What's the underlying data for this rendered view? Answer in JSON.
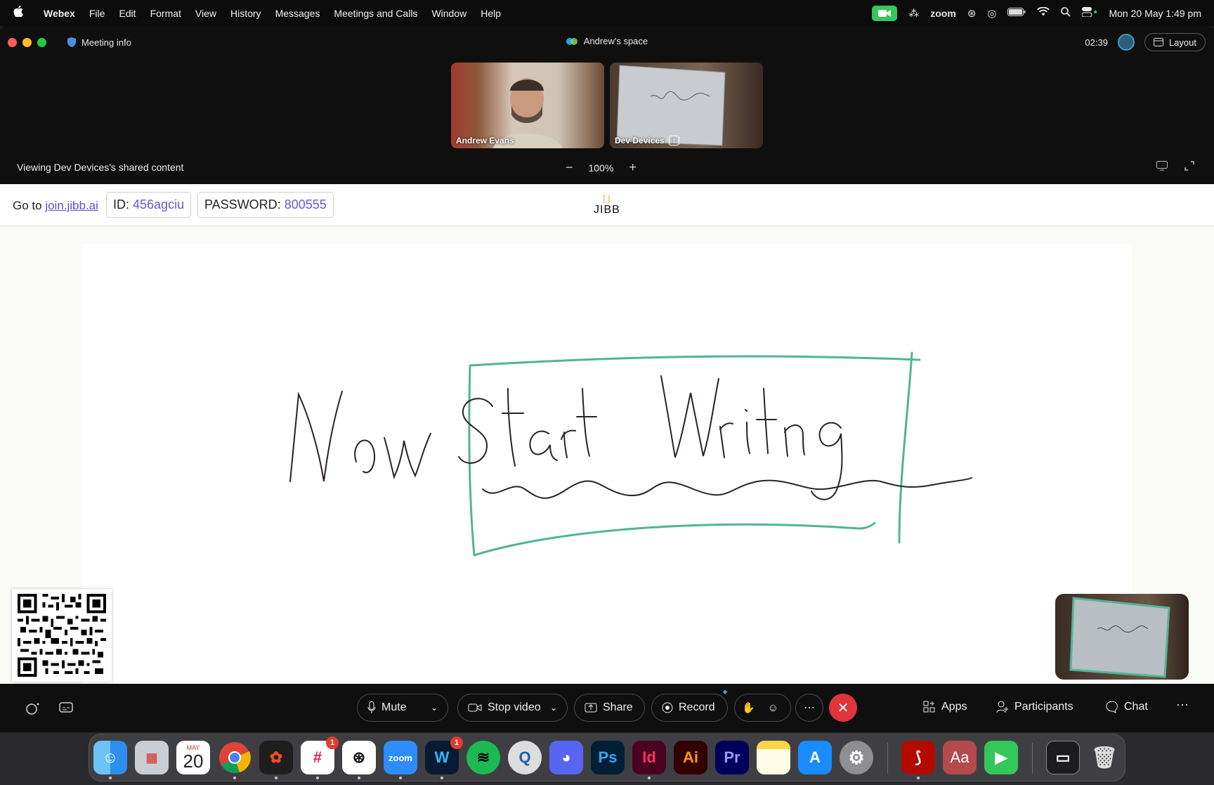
{
  "menubar": {
    "apple": "",
    "app_name": "Webex",
    "menus": [
      "File",
      "Edit",
      "Format",
      "View",
      "History",
      "Messages",
      "Meetings and Calls",
      "Window",
      "Help"
    ],
    "zoom_label": "zoom",
    "datetime": "Mon 20 May  1:49 pm"
  },
  "titlebar": {
    "meeting_info": "Meeting info",
    "space_title": "Andrew's space",
    "timer": "02:39",
    "layout_label": "Layout"
  },
  "strip": {
    "tiles": [
      {
        "name": "Andrew Evans"
      },
      {
        "name": "Dev Devices"
      }
    ],
    "viewing_text": "Viewing Dev Devices's shared content",
    "zoom_level": "100%"
  },
  "jibb": {
    "goto_prefix": "Go to ",
    "goto_link": "join.jibb.ai",
    "id_label": "ID:",
    "id_value": "456agciu",
    "password_label": "PASSWORD:",
    "password_value": "800555",
    "logo_text": "JIBB",
    "whiteboard_text": "Now Start Writing"
  },
  "controls": {
    "mute": "Mute",
    "stop_video": "Stop video",
    "share": "Share",
    "record": "Record",
    "apps": "Apps",
    "participants": "Participants",
    "chat": "Chat"
  },
  "dock": {
    "calendar_month": "MAY",
    "calendar_day": "20",
    "slack_badge": "1",
    "webex_badge": "1",
    "zoom_label": "zoom",
    "ps": "Ps",
    "id": "Id",
    "ai": "Ai",
    "pr": "Pr",
    "aa": "Aa"
  },
  "colors": {
    "accent_purple": "#6a55e0",
    "whiteboard_box": "#4fb596",
    "end_call_red": "#e0353b",
    "camera_green": "#34c759"
  }
}
